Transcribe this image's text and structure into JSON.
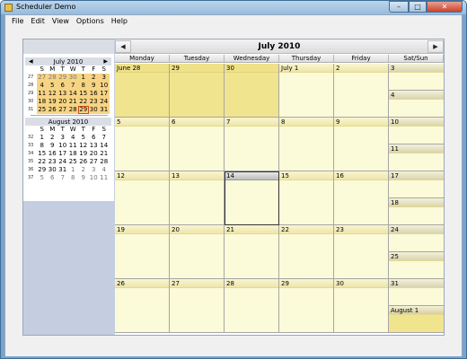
{
  "window": {
    "title": "Scheduler Demo"
  },
  "menu": [
    "File",
    "Edit",
    "View",
    "Options",
    "Help"
  ],
  "nav": {
    "month_title": "July 2010",
    "prev_icon": "chevron-left-icon",
    "next_icon": "chevron-right-icon"
  },
  "weekdays": [
    "Monday",
    "Tuesday",
    "Wednesday",
    "Thursday",
    "Friday",
    "Sat/Sun"
  ],
  "weeks": [
    {
      "days": [
        "June 28",
        "29",
        "30",
        "July 1",
        "2"
      ],
      "weekend": [
        "3",
        "4"
      ],
      "highlighted": [
        0,
        1,
        2
      ]
    },
    {
      "days": [
        "5",
        "6",
        "7",
        "8",
        "9"
      ],
      "weekend": [
        "10",
        "11"
      ],
      "highlighted": []
    },
    {
      "days": [
        "12",
        "13",
        "14",
        "15",
        "16"
      ],
      "weekend": [
        "17",
        "18"
      ],
      "highlighted": [],
      "selected": 2
    },
    {
      "days": [
        "19",
        "20",
        "21",
        "22",
        "23"
      ],
      "weekend": [
        "24",
        "25"
      ],
      "highlighted": []
    },
    {
      "days": [
        "26",
        "27",
        "28",
        "29",
        "30"
      ],
      "weekend": [
        "31",
        "August 1"
      ],
      "highlighted": [],
      "weekend_highlighted": [
        1
      ]
    }
  ],
  "mini_calendars": [
    {
      "title": "July 2010",
      "dows": [
        "S",
        "M",
        "T",
        "W",
        "T",
        "F",
        "S"
      ],
      "rows": [
        {
          "wk": "27",
          "days": [
            "27",
            "28",
            "29",
            "30",
            "1",
            "2",
            "3"
          ],
          "other": [
            0,
            1,
            2,
            3
          ],
          "hl": [
            0,
            1,
            2,
            3,
            4,
            5,
            6
          ]
        },
        {
          "wk": "28",
          "days": [
            "4",
            "5",
            "6",
            "7",
            "8",
            "9",
            "10"
          ],
          "other": [],
          "hl": [
            0,
            1,
            2,
            3,
            4,
            5,
            6
          ]
        },
        {
          "wk": "29",
          "days": [
            "11",
            "12",
            "13",
            "14",
            "15",
            "16",
            "17"
          ],
          "other": [],
          "hl": [
            0,
            1,
            2,
            3,
            4,
            5,
            6
          ]
        },
        {
          "wk": "30",
          "days": [
            "18",
            "19",
            "20",
            "21",
            "22",
            "23",
            "24"
          ],
          "other": [],
          "hl": [
            0,
            1,
            2,
            3,
            4,
            5,
            6
          ]
        },
        {
          "wk": "31",
          "days": [
            "25",
            "26",
            "27",
            "28",
            "29",
            "30",
            "31"
          ],
          "other": [],
          "hl": [
            0,
            1,
            2,
            3,
            4,
            5,
            6
          ],
          "today": 4
        }
      ]
    },
    {
      "title": "August 2010",
      "dows": [
        "S",
        "M",
        "T",
        "W",
        "T",
        "F",
        "S"
      ],
      "rows": [
        {
          "wk": "32",
          "days": [
            "1",
            "2",
            "3",
            "4",
            "5",
            "6",
            "7"
          ],
          "other": [],
          "hl": []
        },
        {
          "wk": "33",
          "days": [
            "8",
            "9",
            "10",
            "11",
            "12",
            "13",
            "14"
          ],
          "other": [],
          "hl": []
        },
        {
          "wk": "34",
          "days": [
            "15",
            "16",
            "17",
            "18",
            "19",
            "20",
            "21"
          ],
          "other": [],
          "hl": []
        },
        {
          "wk": "35",
          "days": [
            "22",
            "23",
            "24",
            "25",
            "26",
            "27",
            "28"
          ],
          "other": [],
          "hl": []
        },
        {
          "wk": "36",
          "days": [
            "29",
            "30",
            "31",
            "1",
            "2",
            "3",
            "4"
          ],
          "other": [
            3,
            4,
            5,
            6
          ],
          "hl": []
        },
        {
          "wk": "37",
          "days": [
            "5",
            "6",
            "7",
            "8",
            "9",
            "10",
            "11"
          ],
          "other": [
            0,
            1,
            2,
            3,
            4,
            5,
            6
          ],
          "hl": []
        }
      ]
    }
  ],
  "colors": {
    "cell": "#fbfad9",
    "highlight": "#f1e48e",
    "mini_highlight": "#f7d484",
    "today_border": "#d04a1a"
  }
}
